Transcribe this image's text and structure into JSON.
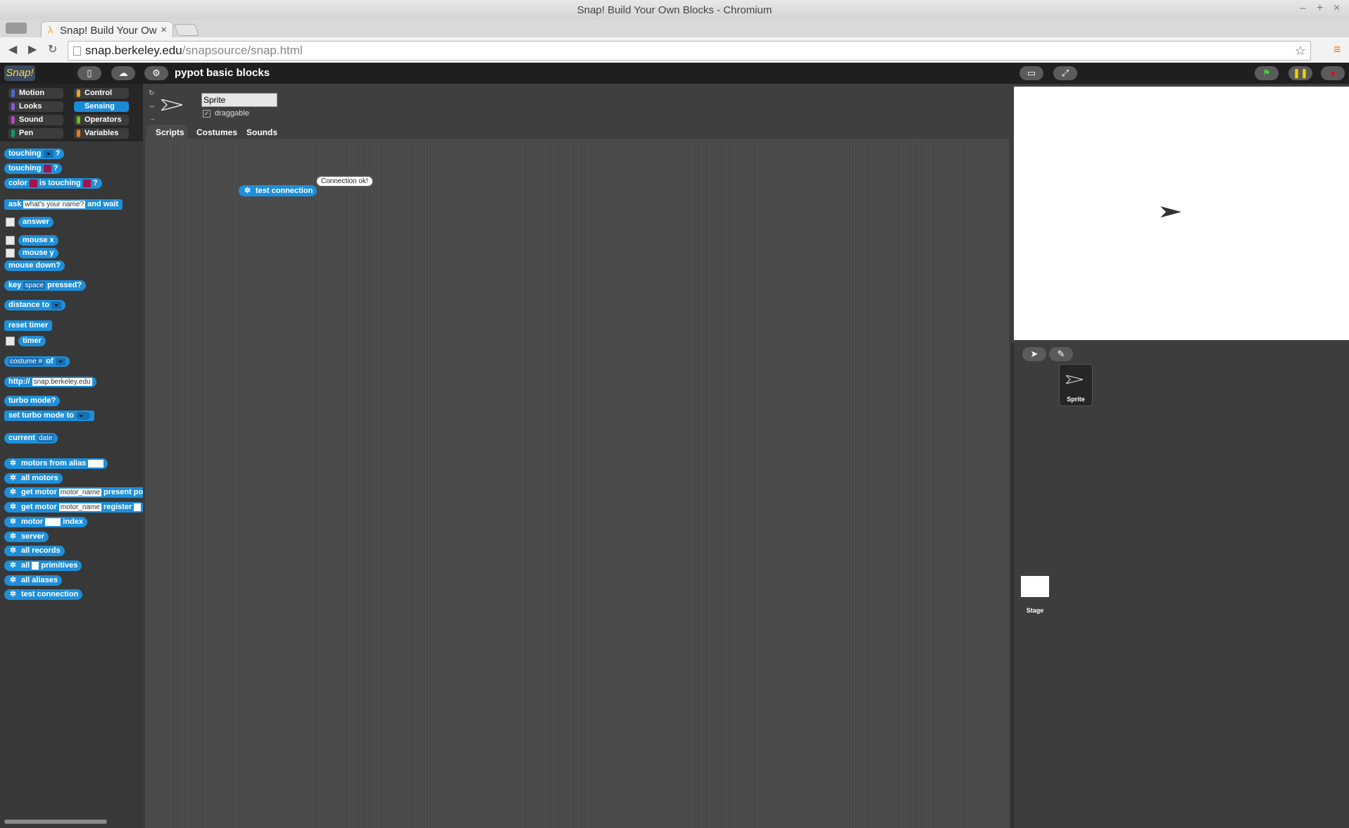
{
  "window": {
    "title": "Snap! Build Your Own Blocks - Chromium"
  },
  "browser": {
    "tab_title": "Snap! Build Your Ow",
    "url_host": "snap.berkeley.edu",
    "url_path": "/snapsource/snap.html"
  },
  "toolbar": {
    "project_name": "pypot basic blocks",
    "logo_text": "Snap!"
  },
  "categories": [
    {
      "label": "Motion",
      "color": "#4a6cd4"
    },
    {
      "label": "Looks",
      "color": "#8a55d7"
    },
    {
      "label": "Sound",
      "color": "#bb42c3"
    },
    {
      "label": "Pen",
      "color": "#0e9a6c"
    },
    {
      "label": "Control",
      "color": "#e6a822"
    },
    {
      "label": "Sensing",
      "color": "#0494dc"
    },
    {
      "label": "Operators",
      "color": "#62c213"
    },
    {
      "label": "Variables",
      "color": "#f3761d"
    }
  ],
  "palette": {
    "touching": "touching",
    "touching2": "touching",
    "color": "color",
    "is_touching": "is touching",
    "q": "?",
    "ask": "ask",
    "ask_default": "what's your name?",
    "and_wait": "and wait",
    "answer": "answer",
    "mouse_x": "mouse x",
    "mouse_y": "mouse y",
    "mouse_down": "mouse down?",
    "key": "key",
    "key_default": "space",
    "pressed": "pressed?",
    "distance_to": "distance to",
    "reset_timer": "reset timer",
    "timer": "timer",
    "costume_num": "costume #",
    "of": "of",
    "http": "http://",
    "http_default": "snap.berkeley.edu",
    "turbo_mode": "turbo mode?",
    "set_turbo": "set turbo mode to",
    "current": "current",
    "date": "date",
    "motors_from_alias": "motors from alias",
    "all_motors": "all motors",
    "get_motor": "get motor",
    "motor_name": "motor_name",
    "present_po": "present po",
    "get_motor2": "get motor",
    "motor_name2": "motor_name",
    "register": "register",
    "motor": "motor",
    "index": "index",
    "server": "server",
    "all_records": "all records",
    "all": "all",
    "primitives": "primitives",
    "all_aliases": "all aliases",
    "test_connection": "test connection"
  },
  "sprite": {
    "name": "Sprite",
    "draggable_label": "draggable",
    "draggable": true
  },
  "tabs": [
    "Scripts",
    "Costumes",
    "Sounds"
  ],
  "script": {
    "block_label": "test connection",
    "bubble_text": "Connection ok!"
  },
  "corral": {
    "sprite_label": "Sprite",
    "stage_label": "Stage"
  }
}
